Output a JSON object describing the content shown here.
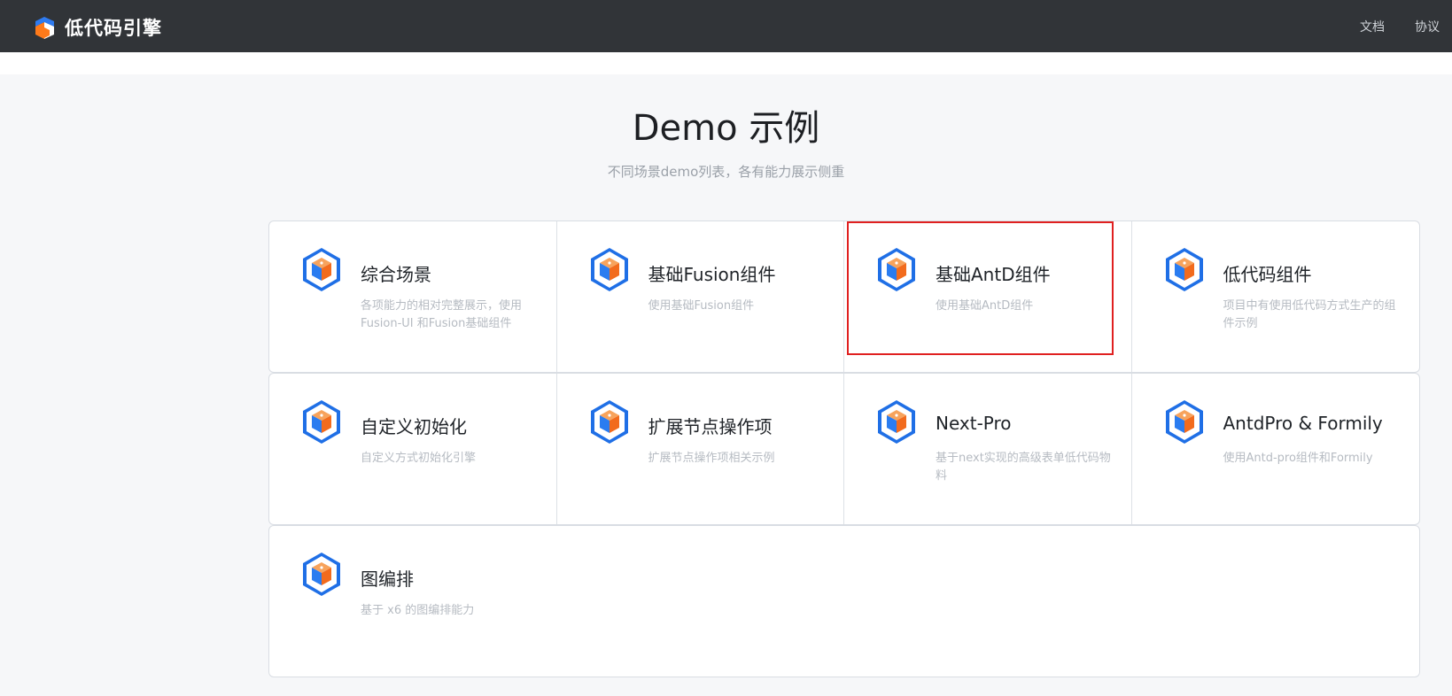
{
  "header": {
    "brand": "低代码引擎",
    "nav": [
      {
        "label": "文档"
      },
      {
        "label": "协议"
      }
    ]
  },
  "hero": {
    "title": "Demo 示例",
    "subtitle": "不同场景demo列表，各有能力展示侧重"
  },
  "cards": [
    {
      "title": "综合场景",
      "desc": "各项能力的相对完整展示，使用 Fusion-UI 和Fusion基础组件",
      "icon": "cube-icon"
    },
    {
      "title": "基础Fusion组件",
      "desc": "使用基础Fusion组件",
      "icon": "cube-icon"
    },
    {
      "title": "基础AntD组件",
      "desc": "使用基础AntD组件",
      "icon": "cube-icon"
    },
    {
      "title": "低代码组件",
      "desc": "项目中有使用低代码方式生产的组件示例",
      "icon": "cube-icon"
    },
    {
      "title": "自定义初始化",
      "desc": "自定义方式初始化引擎",
      "icon": "cube-icon"
    },
    {
      "title": "扩展节点操作项",
      "desc": "扩展节点操作项相关示例",
      "icon": "cube-icon"
    },
    {
      "title": "Next-Pro",
      "desc": "基于next实现的高级表单低代码物料",
      "icon": "cube-icon"
    },
    {
      "title": "AntdPro & Formily",
      "desc": "使用Antd-pro组件和Formily",
      "icon": "cube-icon"
    },
    {
      "title": "图编排",
      "desc": "基于 x6 的图编排能力",
      "icon": "cube-icon"
    }
  ],
  "colors": {
    "header_bg": "#313438",
    "page_bg": "#f6f7f9",
    "highlight": "#e02020",
    "icon_blue": "#1f6fe6",
    "icon_orange": "#f26b1d"
  }
}
